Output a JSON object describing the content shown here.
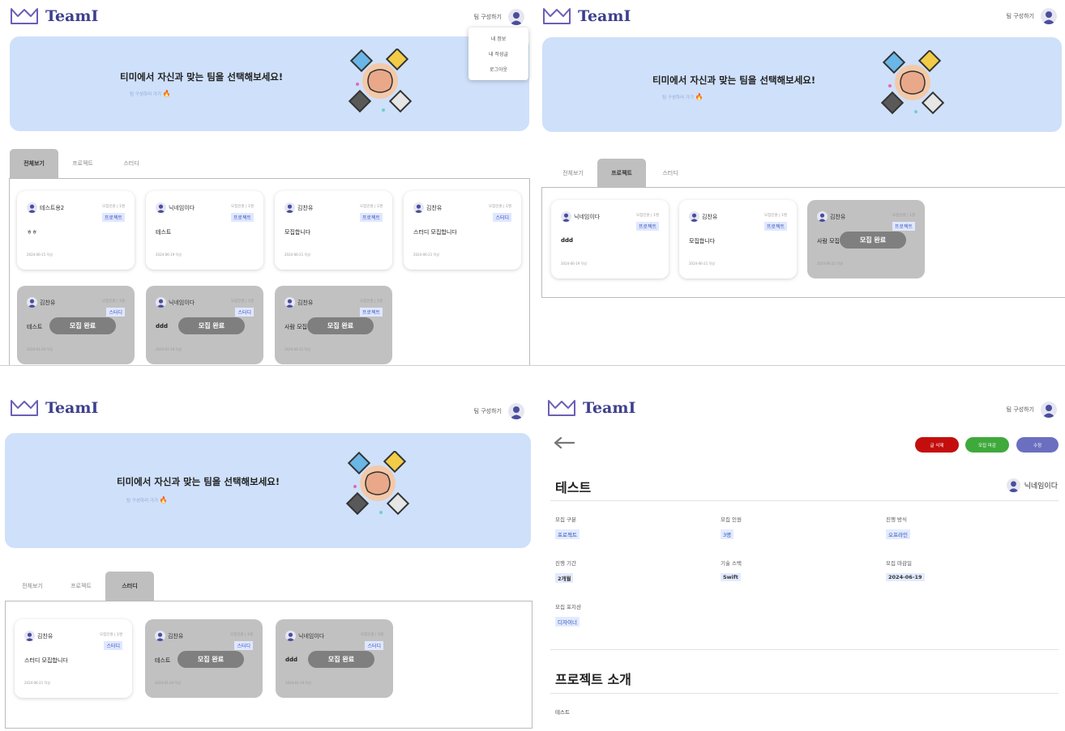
{
  "app": {
    "logo_text": "TeamI",
    "header_link": "팀 구성하기"
  },
  "dropdown": {
    "items": [
      "내 정보",
      "내 작성글",
      "로그아웃"
    ]
  },
  "banner": {
    "title": "티미에서 자신과 맞는 팀을 선택해보세요!",
    "button": "팀 구성하러 가기"
  },
  "tabs": [
    "전체보기",
    "프로젝트",
    "스터디"
  ],
  "closed_label": "모집 완료",
  "views": {
    "all": [
      {
        "user": "테스트용2",
        "count": "모집인원 | 1명",
        "type": "프로젝트",
        "title": "ㅎㅎ",
        "date": "2024-06-15 작성",
        "closed": false
      },
      {
        "user": "닉네임이다",
        "count": "모집인원 | 1명",
        "type": "프로젝트",
        "title": "테스트",
        "date": "2024-06-19 작성",
        "closed": false
      },
      {
        "user": "김찬유",
        "count": "모집인원 | 1명",
        "type": "프로젝트",
        "title": "모집합니다",
        "date": "2024-06-21 작성",
        "closed": false
      },
      {
        "user": "김찬유",
        "count": "모집인원 | 1명",
        "type": "스터디",
        "title": "스터디 모집합니다",
        "date": "2024-06-21 작성",
        "closed": false
      },
      {
        "user": "김찬유",
        "count": "모집인원 | 1명",
        "type": "스터디",
        "title": "테스트",
        "date": "2024-01-20 작성",
        "closed": true
      },
      {
        "user": "닉네임이다",
        "count": "모집인원 | 1명",
        "type": "스터디",
        "title": "ddd",
        "date": "2024-01-19 작성",
        "closed": true
      },
      {
        "user": "김찬유",
        "count": "모집인원 | 1명",
        "type": "프로젝트",
        "title": "사람 모집",
        "date": "2024-06-21 작성",
        "closed": true
      }
    ],
    "project": [
      {
        "user": "닉네임이다",
        "count": "모집인원 | 1명",
        "type": "프로젝트",
        "title": "ddd",
        "date": "2024-06-19 작성",
        "closed": false
      },
      {
        "user": "김찬유",
        "count": "모집인원 | 1명",
        "type": "프로젝트",
        "title": "모집합니다",
        "date": "2024-06-21 작성",
        "closed": false
      },
      {
        "user": "김찬유",
        "count": "모집인원 | 1명",
        "type": "프로젝트",
        "title": "사람 모집",
        "date": "2024-06-21 작성",
        "closed": true
      }
    ],
    "study": [
      {
        "user": "김찬유",
        "count": "모집인원 | 1명",
        "type": "스터디",
        "title": "스터디 모집합니다",
        "date": "2024-06-21 작성",
        "closed": false
      },
      {
        "user": "김찬유",
        "count": "모집인원 | 1명",
        "type": "스터디",
        "title": "테스트",
        "date": "2024-01-20 작성",
        "closed": true
      },
      {
        "user": "닉네임이다",
        "count": "모집인원 | 1명",
        "type": "스터디",
        "title": "ddd",
        "date": "2024-01-19 작성",
        "closed": true
      }
    ]
  },
  "detail": {
    "buttons": {
      "delete": "글 삭제",
      "close": "모집 마감",
      "edit": "수정"
    },
    "button_colors": {
      "delete": "#c40e0e",
      "close": "#3fa93b",
      "edit": "#6b6fc0"
    },
    "title": "테스트",
    "author": "닉네임이다",
    "fields": [
      {
        "label": "모집 구분",
        "value": "프로젝트"
      },
      {
        "label": "모집 인원",
        "value": "3명"
      },
      {
        "label": "진행 방식",
        "value": "오프라인"
      },
      {
        "label": "진행 기간",
        "value": "2개월"
      },
      {
        "label": "기술 스택",
        "value": "Swift"
      },
      {
        "label": "모집 마감일",
        "value": "2024-06-19"
      },
      {
        "label": "모집 포지션",
        "value": "디자이너"
      }
    ],
    "section_title": "프로젝트 소개",
    "body": "테스트"
  },
  "colors": {
    "brand": "#3d3f8c",
    "banner": "#cfe0fa",
    "badge_bg": "#dfe8ff",
    "closed_card": "#c1c1c1"
  }
}
